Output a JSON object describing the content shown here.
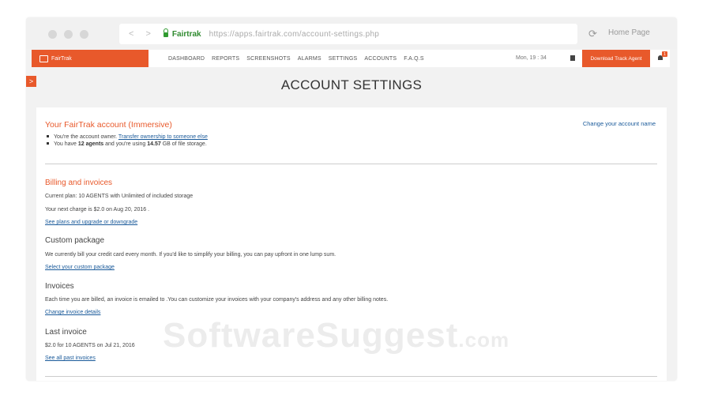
{
  "browser": {
    "site_name": "Fairtrak",
    "url": "https://apps.fairtrak.com/account-settings.php",
    "nav_arrows": "< >",
    "reload_icon": "reload-icon",
    "home_label": "Home Page"
  },
  "appbar": {
    "brand": "FairTrak",
    "menu": [
      "DASHBOARD",
      "REPORTS",
      "SCREENSHOTS",
      "ALARMS",
      "SETTINGS",
      "ACCOUNTS",
      "F.A.Q.S"
    ],
    "datetime": "Mon, 19 : 34",
    "download_label": "Download Track Agent",
    "notification_count": "1"
  },
  "page": {
    "title": "ACCOUNT SETTINGS",
    "side_toggle": ">"
  },
  "account": {
    "title": "Your FairTrak account (Immersive)",
    "change_name": "Change your account name",
    "owner_text": "You're the account owner.",
    "transfer_link": "Transfer ownership to someone else",
    "have_text": "You have",
    "agents": "12 agents",
    "using_text": "and you're using",
    "storage": "14.57",
    "storage_suffix": "GB of file storage."
  },
  "billing": {
    "title": "Billing and invoices",
    "current_plan": "Current plan: 10 AGENTS with Unlimited of included storage",
    "next_charge": "Your next charge is $2.0 on Aug 20, 2016 .",
    "plans_link": "See plans and upgrade or downgrade"
  },
  "custom_package": {
    "title": "Custom package",
    "text": "We currently bill your credit card every month. If you'd like to simplify your billing, you can pay upfront in one lump sum.",
    "link": "Select your custom package"
  },
  "invoices": {
    "title": "Invoices",
    "text": "Each time you are billed, an invoice is emailed to .You can customize your invoices with your company's address and any other billing notes.",
    "link": "Change invoice details"
  },
  "last_invoice": {
    "title": "Last invoice",
    "text": "$2.0 for 10 AGENTS on Jul 21, 2016",
    "link": "See all past invoices"
  },
  "watermark": {
    "main": "SoftwareSuggest",
    "suffix": ".com"
  },
  "colors": {
    "accent": "#e8592b",
    "link": "#1a5a9a",
    "secure": "#2f8a2f"
  }
}
